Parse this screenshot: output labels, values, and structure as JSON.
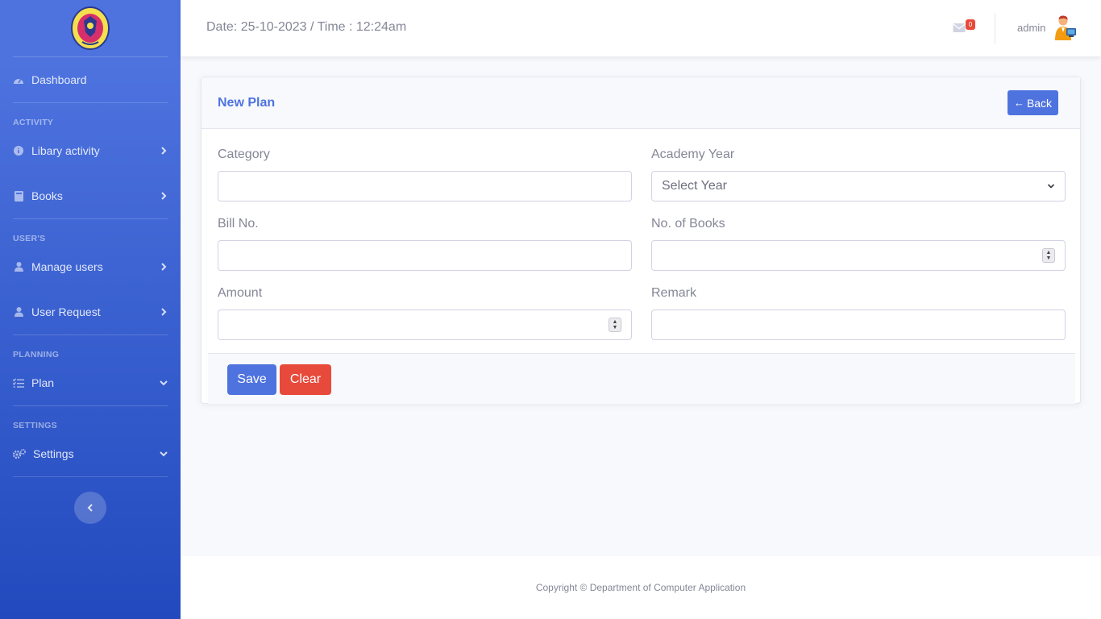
{
  "sidebar": {
    "items": {
      "dashboard": "Dashboard",
      "library_activity": "Libary activity",
      "books": "Books",
      "manage_users": "Manage users",
      "user_request": "User Request",
      "plan": "Plan",
      "settings": "Settings"
    },
    "headings": {
      "activity": "ACTIVITY",
      "users": "USER'S",
      "planning": "PLANNING",
      "settings": "SETTINGS"
    }
  },
  "topbar": {
    "datetime": "Date: 25-10-2023 / Time : 12:24am",
    "mail_count": "0",
    "username": "admin"
  },
  "card": {
    "title": "New Plan",
    "back_label": "Back",
    "fields": {
      "category_label": "Category",
      "academy_year_label": "Academy Year",
      "academy_year_value": "Select Year",
      "bill_no_label": "Bill No.",
      "no_of_books_label": "No. of Books",
      "amount_label": "Amount",
      "remark_label": "Remark"
    },
    "save_label": "Save",
    "clear_label": "Clear"
  },
  "footer": {
    "copyright": "Copyright © Department of Computer Application"
  },
  "colors": {
    "primary": "#4e73df",
    "danger": "#e74a3b",
    "sidebar_gradient_end": "#224abe",
    "text_muted": "#858796"
  }
}
